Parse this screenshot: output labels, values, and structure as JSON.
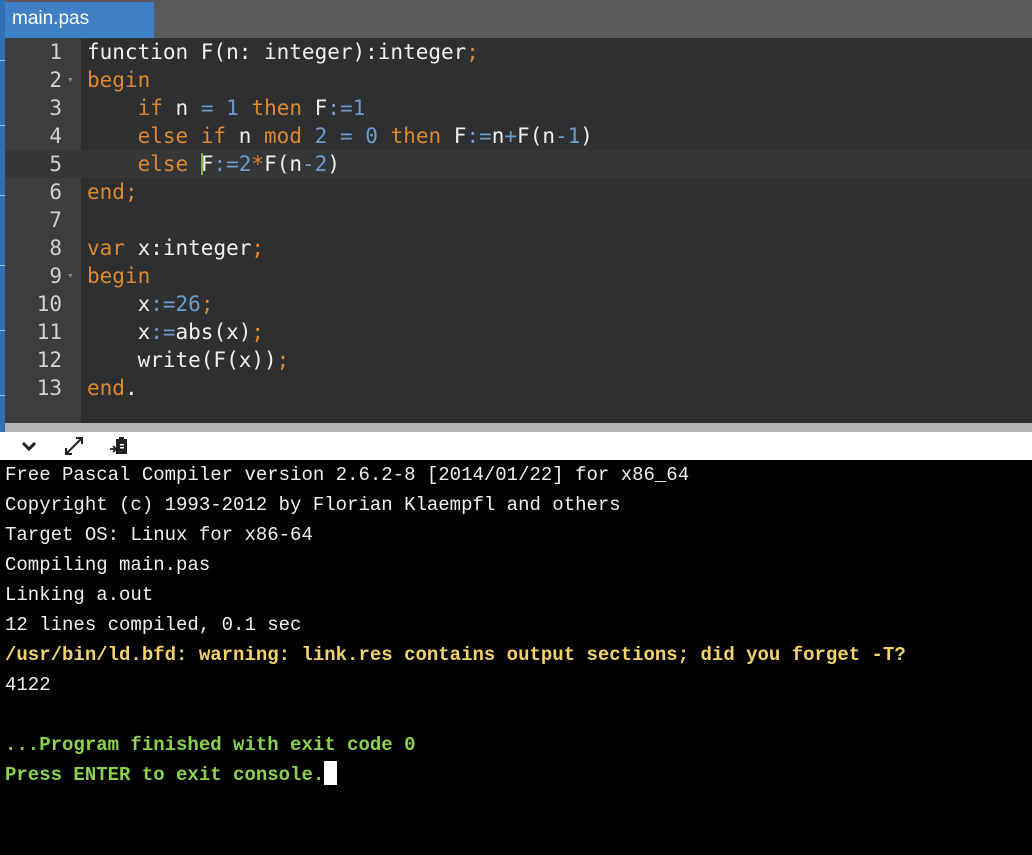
{
  "editor": {
    "tab_label": "main.pas",
    "lines": [
      {
        "n": "1",
        "tokens": [
          [
            "",
            "function F(n: integer):integer"
          ],
          [
            "kw",
            ";"
          ]
        ]
      },
      {
        "n": "2",
        "tokens": [
          [
            "kw",
            "begin"
          ]
        ]
      },
      {
        "n": "3",
        "tokens": [
          [
            "",
            "    "
          ],
          [
            "kw",
            "if"
          ],
          [
            "",
            " n "
          ],
          [
            "op",
            "="
          ],
          [
            "",
            " "
          ],
          [
            "num",
            "1"
          ],
          [
            "",
            " "
          ],
          [
            "kw",
            "then"
          ],
          [
            "",
            " F"
          ],
          [
            "op",
            ":="
          ],
          [
            "num",
            "1"
          ]
        ]
      },
      {
        "n": "4",
        "tokens": [
          [
            "",
            "    "
          ],
          [
            "kw",
            "else if"
          ],
          [
            "",
            " n "
          ],
          [
            "kw",
            "mod"
          ],
          [
            "",
            " "
          ],
          [
            "num",
            "2"
          ],
          [
            "",
            " "
          ],
          [
            "op",
            "="
          ],
          [
            "",
            " "
          ],
          [
            "num",
            "0"
          ],
          [
            "",
            " "
          ],
          [
            "kw",
            "then"
          ],
          [
            "",
            " F"
          ],
          [
            "op",
            ":="
          ],
          [
            "",
            "n"
          ],
          [
            "op",
            "+"
          ],
          [
            "",
            "F(n"
          ],
          [
            "op",
            "-"
          ],
          [
            "num",
            "1"
          ],
          [
            "",
            ")"
          ]
        ]
      },
      {
        "n": "5",
        "tokens": [
          [
            "",
            "    "
          ],
          [
            "kw",
            "else"
          ],
          [
            "",
            " "
          ],
          [
            "cursor",
            ""
          ],
          [
            "",
            "F"
          ],
          [
            "op",
            ":="
          ],
          [
            "num",
            "2"
          ],
          [
            "kw",
            "*"
          ],
          [
            "",
            "F(n"
          ],
          [
            "op",
            "-"
          ],
          [
            "num",
            "2"
          ],
          [
            "",
            ")"
          ]
        ]
      },
      {
        "n": "6",
        "tokens": [
          [
            "kw",
            "end"
          ],
          [
            "kw",
            ";"
          ]
        ]
      },
      {
        "n": "7",
        "tokens": []
      },
      {
        "n": "8",
        "tokens": [
          [
            "kw",
            "var"
          ],
          [
            "",
            " x:integer"
          ],
          [
            "kw",
            ";"
          ]
        ]
      },
      {
        "n": "9",
        "tokens": [
          [
            "kw",
            "begin"
          ]
        ]
      },
      {
        "n": "10",
        "tokens": [
          [
            "",
            "    x"
          ],
          [
            "op",
            ":="
          ],
          [
            "num",
            "26"
          ],
          [
            "kw",
            ";"
          ]
        ]
      },
      {
        "n": "11",
        "tokens": [
          [
            "",
            "    x"
          ],
          [
            "op",
            ":="
          ],
          [
            "",
            "abs(x)"
          ],
          [
            "kw",
            ";"
          ]
        ]
      },
      {
        "n": "12",
        "tokens": [
          [
            "",
            "    write(F(x))"
          ],
          [
            "kw",
            ";"
          ]
        ]
      },
      {
        "n": "13",
        "tokens": [
          [
            "kw",
            "end"
          ],
          [
            "",
            "."
          ]
        ]
      }
    ],
    "foldable_lines": [
      "2",
      "9"
    ],
    "active_line": "5"
  },
  "console": {
    "lines": [
      {
        "style": "normal",
        "text": "Free Pascal Compiler version 2.6.2-8 [2014/01/22] for x86_64"
      },
      {
        "style": "normal",
        "text": "Copyright (c) 1993-2012 by Florian Klaempfl and others"
      },
      {
        "style": "normal",
        "text": "Target OS: Linux for x86-64"
      },
      {
        "style": "normal",
        "text": "Compiling main.pas"
      },
      {
        "style": "normal",
        "text": "Linking a.out"
      },
      {
        "style": "normal",
        "text": "12 lines compiled, 0.1 sec"
      },
      {
        "style": "warn",
        "text": "/usr/bin/ld.bfd: warning: link.res contains output sections; did you forget -T?"
      },
      {
        "style": "normal",
        "text": "4122"
      },
      {
        "style": "normal",
        "text": ""
      },
      {
        "style": "ok",
        "text": "...Program finished with exit code 0"
      },
      {
        "style": "ok",
        "text": "Press ENTER to exit console."
      }
    ]
  },
  "toolbar": {
    "icons": [
      "chevron-down-icon",
      "expand-icon",
      "clipboard-paste-icon"
    ]
  },
  "colors": {
    "keyword": "#e0882f",
    "number": "#6c9cd4",
    "warning": "#f3d36a",
    "success": "#8bd24f",
    "tab": "#3f7fc3"
  }
}
